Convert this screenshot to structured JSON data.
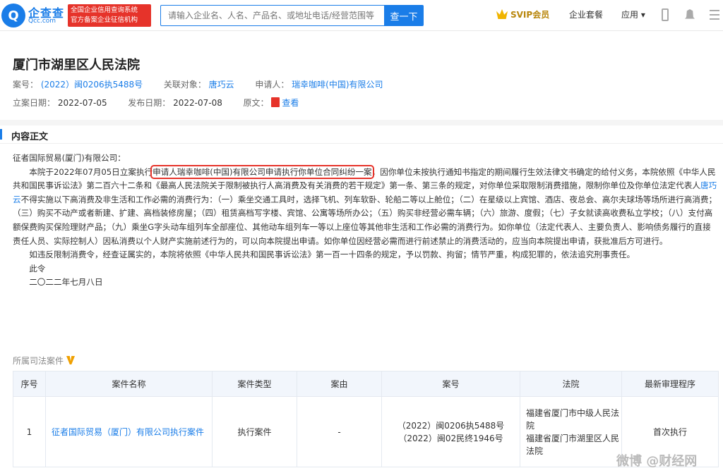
{
  "header": {
    "logo_char": "Q",
    "logo_text": "企查查",
    "logo_sub": "Qcc.com",
    "badge_line1": "全国企业信用查询系统",
    "badge_line2": "官方备案企业征信机构",
    "search_placeholder": "请输入企业名、人名、产品名、或地址电话/经营范围等",
    "search_button": "查一下",
    "svip": "SVIP会员",
    "package": "企业套餐",
    "app": "应用 ▾"
  },
  "doc": {
    "title": "厦门市湖里区人民法院",
    "case_no_label": "案号：",
    "case_no": "(2022）闽0206执5488号",
    "related_label": "关联对象：",
    "related": "唐巧云",
    "applicant_label": "申请人：",
    "applicant": "瑞幸咖啡(中国)有限公司",
    "filed_label": "立案日期：",
    "filed": "2022-07-05",
    "published_label": "发布日期：",
    "published": "2022-07-08",
    "original_label": "原文：",
    "original_link": "查看"
  },
  "content": {
    "section_title": "内容正文",
    "salutation": "征者国际贸易(厦门)有限公司：",
    "p1_a": "本院于2022年07月05日立案执行",
    "p1_hl": "申请人瑞幸咖啡(中国)有限公司申请执行你单位合同纠纷一案",
    "p1_b": "，因你单位未按执行通知书指定的期间履行生效法律文书确定的给付义务，本院依照《中华人民共和国民事诉讼法》第二百六十二条和《最高人民法院关于限制被执行人高消费及有关消费的若干规定》第一条、第三条的规定，对你单位采取限制消费措施，限制你单位及你单位法定代表人",
    "p1_link": "唐巧云",
    "p1_c": "不得实施以下高消费及非生活和工作必需的消费行为：（一）乘坐交通工具时，选择飞机、列车软卧、轮船二等以上舱位；（二）在星级以上宾馆、酒店、夜总会、高尔夫球场等场所进行高消费；（三）购买不动产或者新建、扩建、高档装修房屋；（四）租赁高档写字楼、宾馆、公寓等场所办公；（五）购买非经营必需车辆；（六）旅游、度假；（七）子女就读高收费私立学校；（八）支付高额保费购买保险理财产品；（九）乘坐G字头动车组列车全部座位、其他动车组列车一等以上座位等其他非生活和工作必需的消费行为。如你单位（法定代表人、主要负责人、影响债务履行的直接责任人员、实际控制人）因私消费以个人财产实施前述行为的，可以向本院提出申请。如你单位因经营必需而进行前述禁止的消费活动的，应当向本院提出申请，获批准后方可进行。",
    "p2": "如违反限制消费令，经查证属实的，本院将依照《中华人民共和国民事诉讼法》第一百一十四条的规定，予以罚款、拘留；情节严重，构成犯罪的，依法追究刑事责任。",
    "p3": "此令",
    "p4": "二〇二二年七月八日"
  },
  "cases": {
    "label": "所属司法案件",
    "headers": [
      "序号",
      "案件名称",
      "案件类型",
      "案由",
      "案号",
      "法院",
      "最新审理程序"
    ],
    "row": {
      "no": "1",
      "name": "征者国际贸易（厦门）有限公司执行案件",
      "type": "执行案件",
      "cause": "-",
      "case_no_1": "（2022）闽0206执5488号",
      "case_no_2": "（2022）闽02民终1946号",
      "court_1": "福建省厦门市中级人民法院",
      "court_2": "福建省厦门市湖里区人民法院",
      "procedure": "首次执行"
    }
  },
  "watermark": "微博 @财经网"
}
